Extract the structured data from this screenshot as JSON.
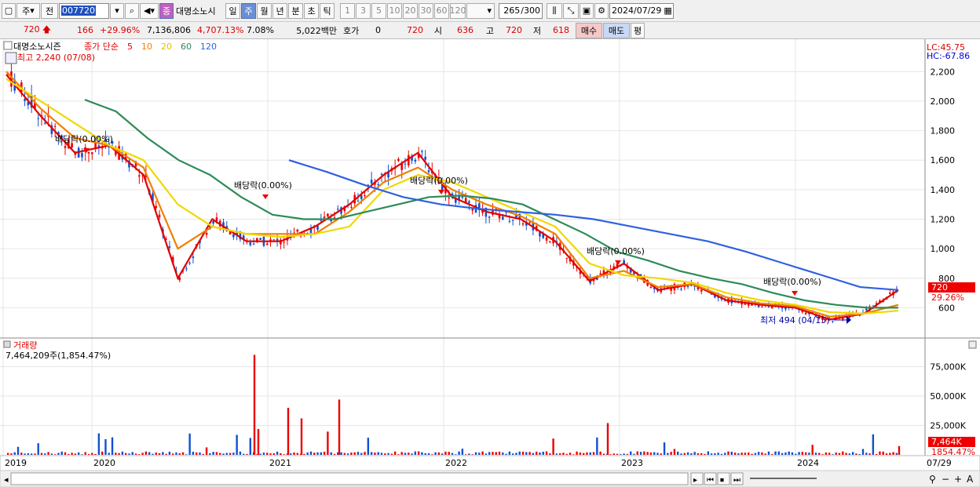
{
  "toolbar": {
    "period_label": "주",
    "prev_label": "전",
    "code": "007720",
    "stock_name": "대명소노시",
    "tabs": [
      {
        "label": "일",
        "sel": false
      },
      {
        "label": "주",
        "sel": true
      },
      {
        "label": "월",
        "sel": false
      },
      {
        "label": "년",
        "sel": false
      },
      {
        "label": "분",
        "sel": false
      },
      {
        "label": "초",
        "sel": false
      },
      {
        "label": "틱",
        "sel": false
      },
      {
        "label": "1",
        "sel": false
      },
      {
        "label": "3",
        "sel": false
      },
      {
        "label": "5",
        "sel": false
      },
      {
        "label": "10",
        "sel": false
      },
      {
        "label": "20",
        "sel": false
      },
      {
        "label": "30",
        "sel": false
      },
      {
        "label": "60",
        "sel": false
      },
      {
        "label": "120",
        "sel": false
      }
    ],
    "count": "265",
    "count_total": "/300",
    "date": "2024/07/29"
  },
  "quote": {
    "price": "720",
    "change": "166",
    "change_pct": "+29.96%",
    "volume": "7,136,806",
    "volume_pct": "4,707.13%",
    "turnover": "7.08%",
    "amount": "5,022백만",
    "hoga_label": "호가",
    "hoga_value": "0",
    "ask": "720",
    "open_label": "시",
    "open": "636",
    "high_label": "고",
    "high": "720",
    "low_label": "저",
    "low": "618",
    "buy_label": "매수",
    "sell_label": "매도",
    "avg_label": "평"
  },
  "price_panel": {
    "name": "대명소노시즌",
    "ma_label": "종가 단순",
    "ma_periods": [
      "5",
      "10",
      "20",
      "60",
      "120"
    ],
    "ma_colors": [
      "#e00000",
      "#f08000",
      "#f0d800",
      "#2e8b57",
      "#3060e0"
    ],
    "high_note": "최고 2,240 (07/08)",
    "low_note": "최저 494 (04/15)",
    "lc": "LC:45.75",
    "hc": "HC:-67.86",
    "current_price": "720",
    "current_pct": "29.26%",
    "dividend_labels": [
      "배당락(0.00%)",
      "배당락(0.00%)",
      "배당락(0.00%)",
      "배당락(0.00%)",
      "배당락(0.00%)"
    ]
  },
  "volume_panel": {
    "label": "거래량",
    "info": "7,464,209주(1,854.47%)",
    "current": "7,464K",
    "current_pct": "1854.47%"
  },
  "chart_data": [
    {
      "type": "line",
      "title": "대명소노시즌",
      "ylim": [
        480,
        2260
      ],
      "yticks": [
        600,
        800,
        1000,
        1200,
        1400,
        1600,
        1800,
        2000,
        2200
      ],
      "yticklabels": [
        "600",
        "800",
        "1,000",
        "1,200",
        "1,400",
        "1,600",
        "1,800",
        "2,000",
        "2,200"
      ],
      "x": [
        "2019-01",
        "2019-04",
        "2019-07",
        "2019-10",
        "2020-01",
        "2020-04",
        "2020-07",
        "2020-10",
        "2021-01",
        "2021-04",
        "2021-07",
        "2021-10",
        "2022-01",
        "2022-04",
        "2022-07",
        "2022-10",
        "2023-01",
        "2023-04",
        "2023-07",
        "2023-10",
        "2024-01",
        "2024-04",
        "2024-07"
      ],
      "series": [
        {
          "name": "5",
          "color": "#e00000",
          "values": [
            2180,
            1900,
            1650,
            1700,
            1500,
            800,
            1200,
            1050,
            1050,
            1150,
            1300,
            1500,
            1650,
            1350,
            1250,
            1200,
            1050,
            780,
            900,
            720,
            760,
            650,
            620,
            600,
            520,
            560,
            720
          ]
        },
        {
          "name": "10",
          "color": "#f08000",
          "values": [
            2200,
            1950,
            1750,
            1700,
            1550,
            1000,
            1150,
            1100,
            1100,
            1100,
            1250,
            1450,
            1550,
            1400,
            1300,
            1220,
            1100,
            800,
            850,
            740,
            760,
            670,
            630,
            610,
            540,
            560,
            620
          ]
        },
        {
          "name": "20",
          "color": "#f0d800",
          "values": [
            2150,
            2000,
            1850,
            1700,
            1600,
            1300,
            1150,
            1100,
            1080,
            1100,
            1150,
            1400,
            1500,
            1450,
            1350,
            1250,
            1150,
            900,
            820,
            800,
            770,
            700,
            650,
            620,
            570,
            560,
            580
          ]
        },
        {
          "name": "60",
          "color": "#2e8b57",
          "values": [
            2010,
            1930,
            1750,
            1600,
            1500,
            1350,
            1230,
            1200,
            1200,
            1250,
            1300,
            1350,
            1360,
            1340,
            1300,
            1200,
            1100,
            980,
            920,
            850,
            800,
            760,
            700,
            650,
            620,
            600,
            600
          ]
        },
        {
          "name": "120",
          "color": "#3060e0",
          "values": [
            1600,
            1520,
            1430,
            1350,
            1300,
            1270,
            1250,
            1230,
            1200,
            1150,
            1100,
            1050,
            980,
            900,
            820,
            740,
            720
          ]
        }
      ]
    },
    {
      "type": "bar",
      "title": "거래량",
      "yticks": [
        25000,
        50000,
        75000
      ],
      "yticklabels": [
        "25,000K",
        "50,000K",
        "75,000K"
      ],
      "xticklabels": [
        "2019",
        "2020",
        "2021",
        "2022",
        "2023",
        "2024",
        "07/29"
      ]
    }
  ]
}
